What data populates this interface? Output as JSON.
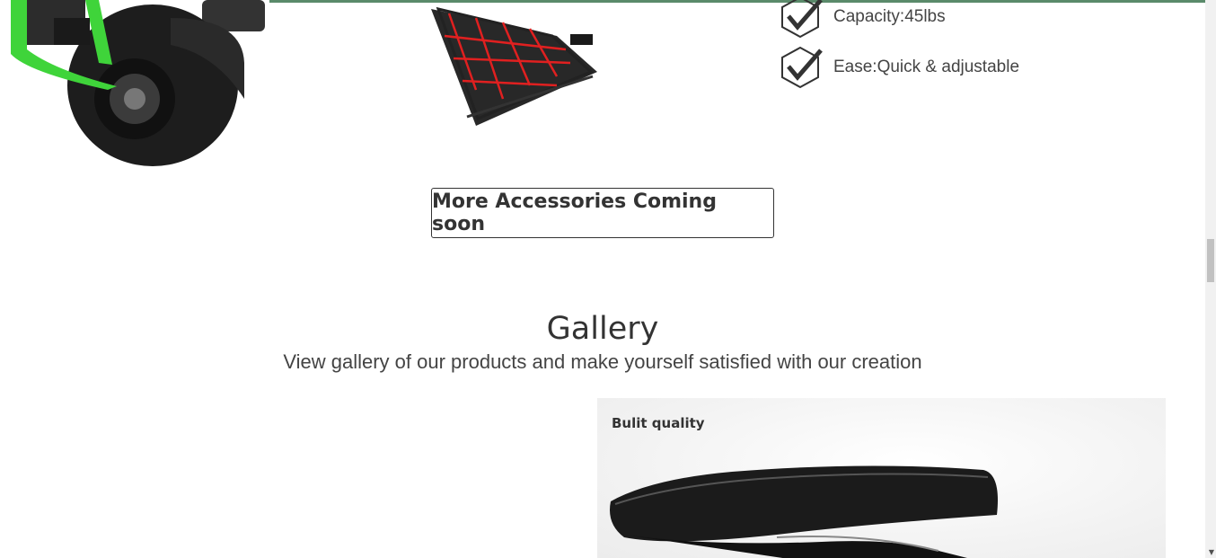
{
  "features": [
    {
      "icon": "check-hexagon-icon",
      "text": "Capacity:45lbs"
    },
    {
      "icon": "check-hexagon-icon",
      "text": "Ease:Quick & adjustable"
    }
  ],
  "accessories": {
    "more_button_label": "More Accessories Coming soon"
  },
  "gallery": {
    "title": "Gallery",
    "subtitle": "View gallery of our products and make yourself satisfied with our creation",
    "cards": [
      {
        "label": "Bulit quality"
      }
    ]
  },
  "colors": {
    "top_bar": "#5a8a6a",
    "scooter_frame": "#3fd43a",
    "basket_net": "#e02020"
  }
}
